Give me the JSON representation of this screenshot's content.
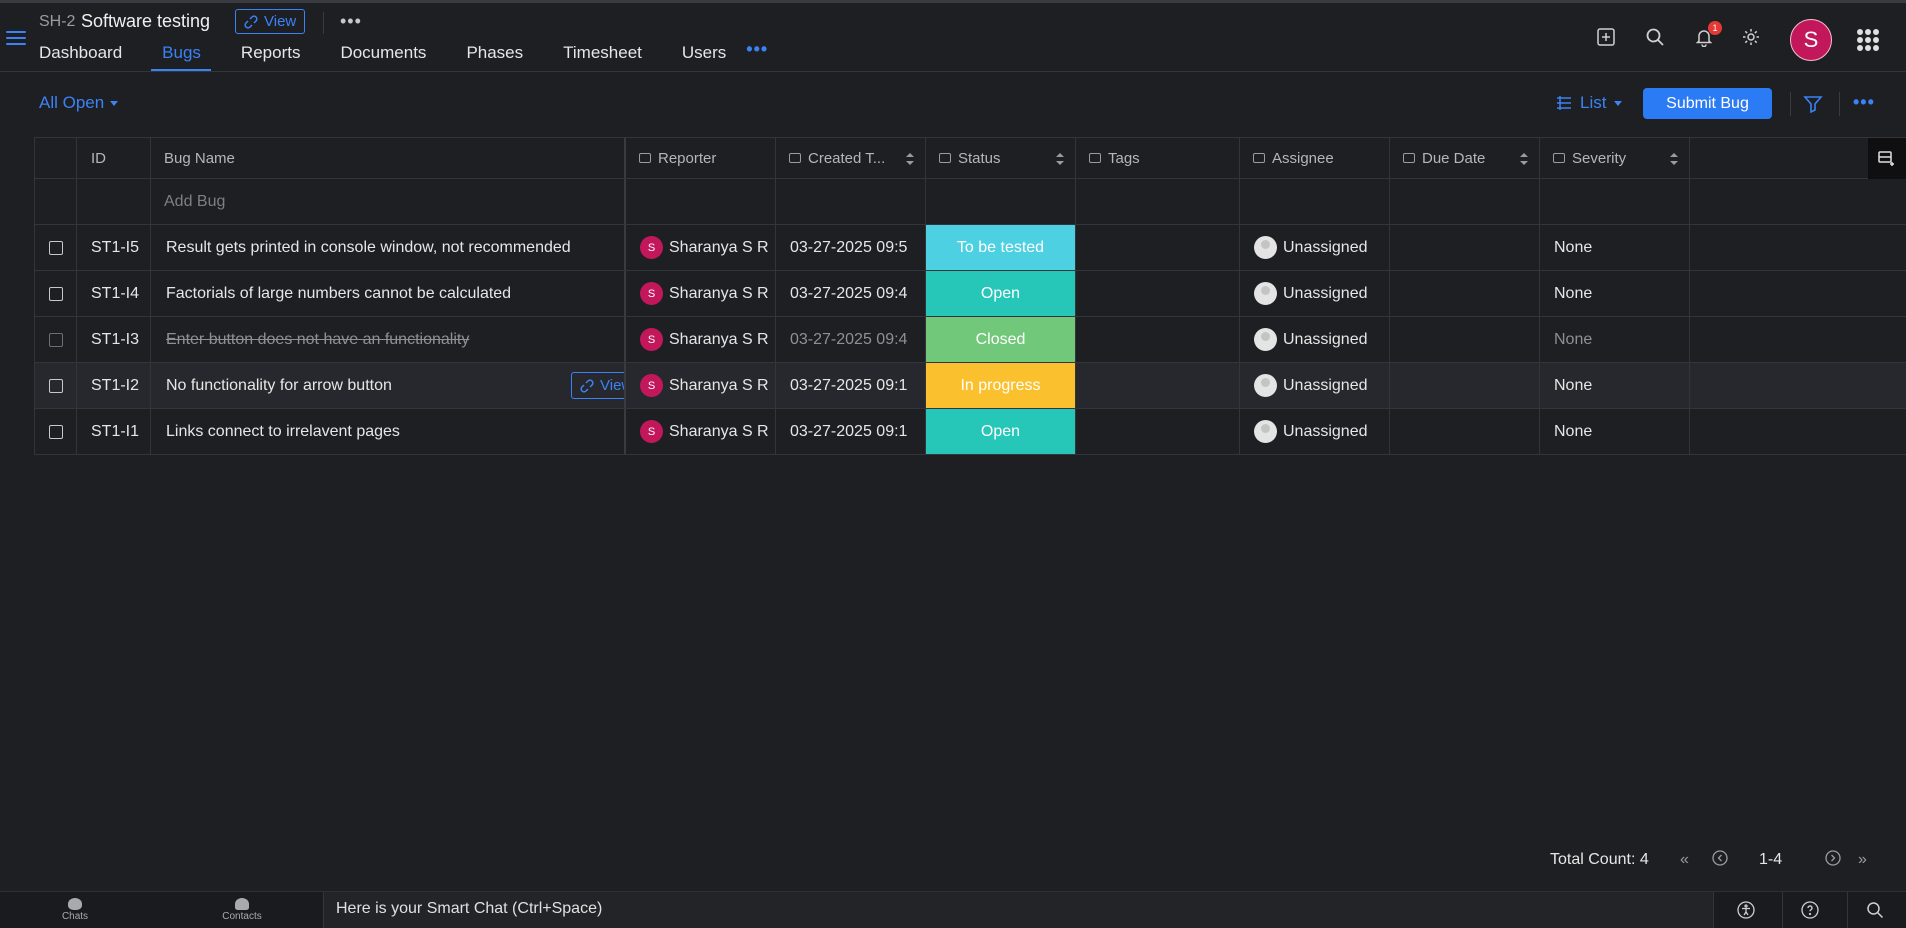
{
  "project": {
    "key": "SH-2",
    "name": "Software testing",
    "view_label": "View"
  },
  "nav": {
    "tabs": [
      {
        "label": "Dashboard"
      },
      {
        "label": "Bugs"
      },
      {
        "label": "Reports"
      },
      {
        "label": "Documents"
      },
      {
        "label": "Phases"
      },
      {
        "label": "Timesheet"
      },
      {
        "label": "Users"
      }
    ],
    "active": "Bugs",
    "more": "•••"
  },
  "header": {
    "notification_count": "1",
    "avatar_initial": "S"
  },
  "toolbar": {
    "filter_label": "All Open",
    "layout_label": "List",
    "submit_label": "Submit Bug",
    "more": "•••"
  },
  "table": {
    "columns": {
      "id": "ID",
      "name": "Bug Name",
      "reporter": "Reporter",
      "created": "Created T...",
      "status": "Status",
      "tags": "Tags",
      "assignee": "Assignee",
      "due": "Due Date",
      "severity": "Severity"
    },
    "add_placeholder": "Add Bug",
    "row_view_label": "View",
    "rows": [
      {
        "id": "ST1-I5",
        "name": "Result gets printed in console window, not recommended",
        "reporter_initial": "S",
        "reporter": "Sharanya S R",
        "created": "03-27-2025 09:5",
        "status": "To be tested",
        "status_color": "#4dd0e1",
        "tags": "",
        "assignee": "Unassigned",
        "due": "",
        "severity": "None"
      },
      {
        "id": "ST1-I4",
        "name": "Factorials of large numbers cannot be calculated",
        "reporter_initial": "S",
        "reporter": "Sharanya S R",
        "created": "03-27-2025 09:4",
        "status": "Open",
        "status_color": "#26c6b8",
        "tags": "",
        "assignee": "Unassigned",
        "due": "",
        "severity": "None"
      },
      {
        "id": "ST1-I3",
        "name": "Enter button does not have an functionality",
        "reporter_initial": "S",
        "reporter": "Sharanya S R",
        "created": "03-27-2025 09:4",
        "status": "Closed",
        "status_color": "#72c87a",
        "tags": "",
        "assignee": "Unassigned",
        "due": "",
        "severity": "None"
      },
      {
        "id": "ST1-I2",
        "name": "No functionality for arrow button",
        "reporter_initial": "S",
        "reporter": "Sharanya S R",
        "created": "03-27-2025 09:1",
        "status": "In progress",
        "status_color": "#fbc02d",
        "tags": "",
        "assignee": "Unassigned",
        "due": "",
        "severity": "None"
      },
      {
        "id": "ST1-I1",
        "name": "Links connect to irrelavent pages",
        "reporter_initial": "S",
        "reporter": "Sharanya S R",
        "created": "03-27-2025 09:1",
        "status": "Open",
        "status_color": "#26c6b8",
        "tags": "",
        "assignee": "Unassigned",
        "due": "",
        "severity": "None"
      }
    ]
  },
  "pagination": {
    "total": "Total Count: 4",
    "range": "1-4"
  },
  "footer": {
    "chats": "Chats",
    "contacts": "Contacts",
    "smart_chat": "Here is your Smart Chat (Ctrl+Space)"
  }
}
